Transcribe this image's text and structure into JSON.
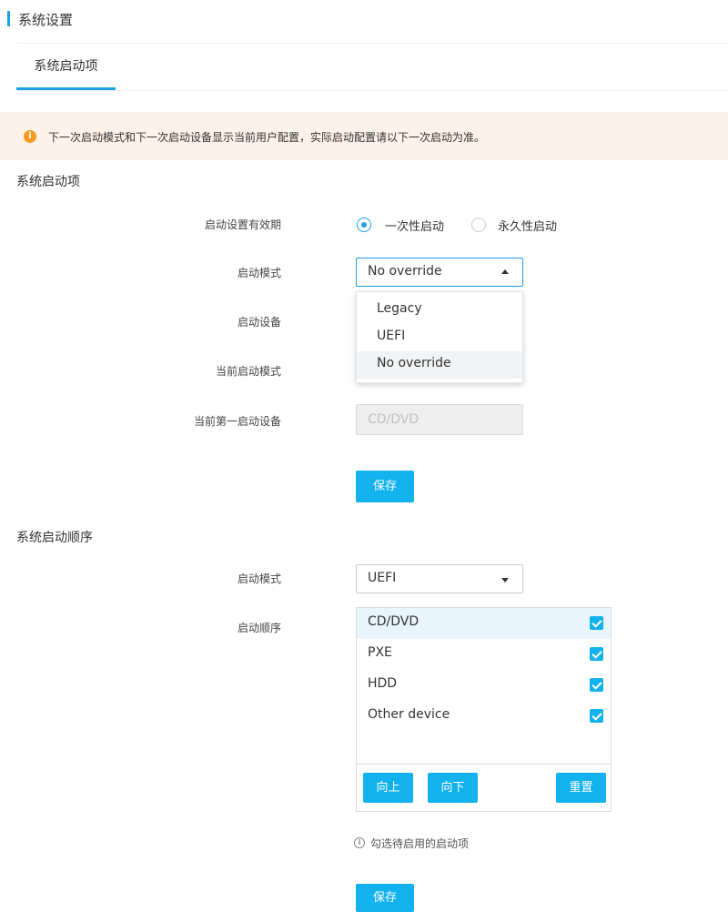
{
  "header": {
    "title": "系统设置"
  },
  "tabs": [
    {
      "label": "系统启动项",
      "active": true
    }
  ],
  "notice": {
    "icon": "info-circle-icon",
    "text": "下一次启动模式和下一次启动设备显示当前用户配置，实际启动配置请以下一次启动为准。"
  },
  "boot_options": {
    "section_title": "系统启动项",
    "validity": {
      "label": "启动设置有效期",
      "options": [
        {
          "label": "一次性启动",
          "selected": true
        },
        {
          "label": "永久性启动",
          "selected": false
        }
      ]
    },
    "boot_mode": {
      "label": "启动模式",
      "value": "No override",
      "dropdown_open": true,
      "options": [
        "Legacy",
        "UEFI",
        "No override"
      ]
    },
    "boot_device": {
      "label": "启动设备"
    },
    "current_boot_mode": {
      "label": "当前启动模式"
    },
    "current_first_device": {
      "label": "当前第一启动设备",
      "value": "CD/DVD"
    },
    "save_label": "保存"
  },
  "boot_order": {
    "section_title": "系统启动顺序",
    "mode": {
      "label": "启动模式",
      "value": "UEFI"
    },
    "order_label": "启动顺序",
    "items": [
      {
        "label": "CD/DVD",
        "checked": true
      },
      {
        "label": "PXE",
        "checked": true
      },
      {
        "label": "HDD",
        "checked": true
      },
      {
        "label": "Other device",
        "checked": true
      }
    ],
    "up_label": "向上",
    "down_label": "向下",
    "reset_label": "重置",
    "hint": "勾选待启用的启动项",
    "save_label": "保存"
  },
  "colors": {
    "accent": "#12b2ee",
    "notice_bg": "#fdf2e9",
    "notice_icon": "#f59a23"
  }
}
